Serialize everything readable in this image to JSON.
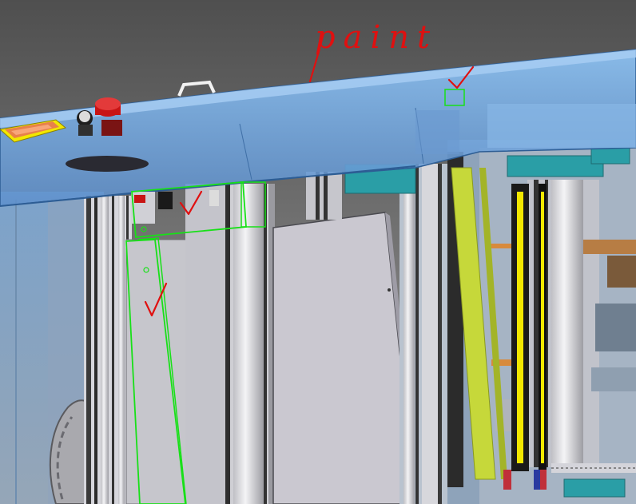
{
  "markup": {
    "handwritten_label": "paint",
    "ink_red": "#e01010",
    "ink_green": "#18e018"
  },
  "colors": {
    "background_top": "#5a5a5a",
    "background_bottom": "#8a8a8a",
    "glass_cover": "#7fb2e8",
    "rail_light": "#e6e6ea",
    "rail_dark": "#3a3a3a",
    "panel": "#c8c8d2",
    "teal_block": "#2a9ea6",
    "light_curtain_yellow": "#f2e800",
    "light_curtain_lime": "#c6d83a",
    "estop_red": "#c81414",
    "copper": "#d88a3c"
  }
}
